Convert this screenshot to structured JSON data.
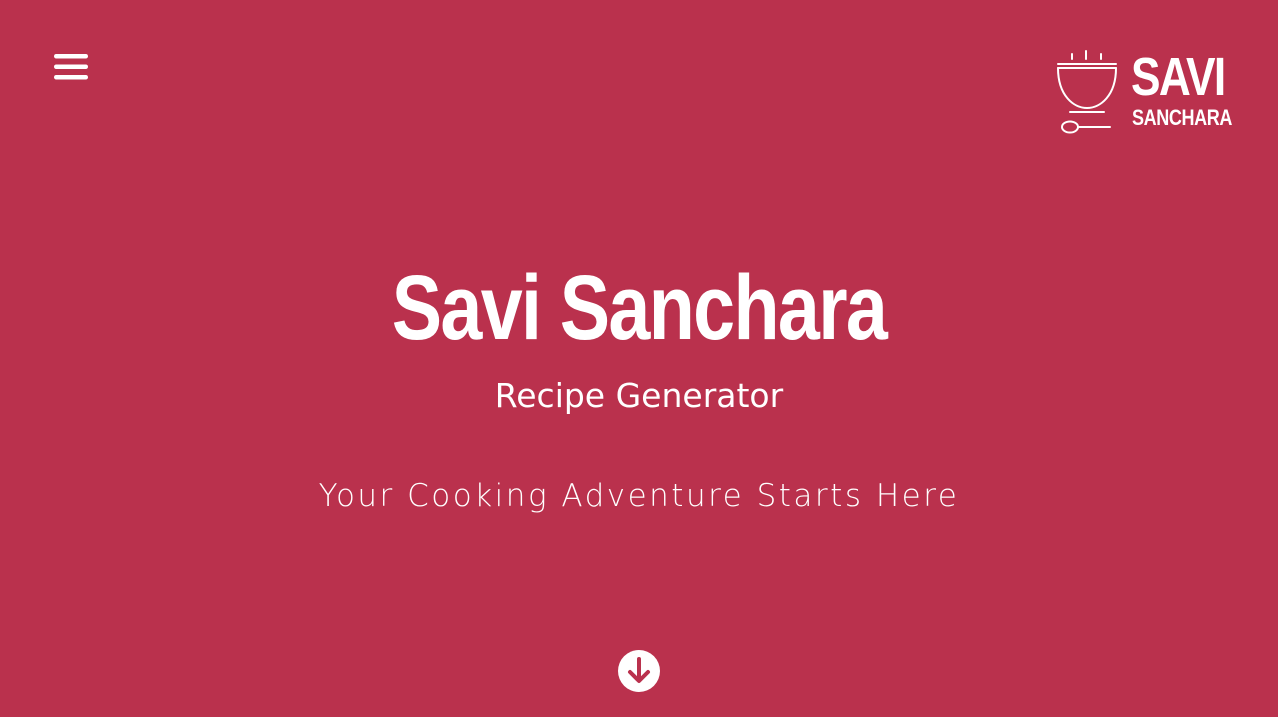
{
  "header": {
    "menu_icon": "hamburger-menu-icon",
    "logo": {
      "icon": "cooking-pot-spoon-icon",
      "line1": "SAVI",
      "line2": "SANCHARA"
    }
  },
  "hero": {
    "title": "Savi Sanchara",
    "subtitle": "Recipe Generator",
    "tagline": "Your Cooking Adventure Starts Here"
  },
  "scroll": {
    "icon": "arrow-down-circle-icon"
  },
  "colors": {
    "background": "#BA314D",
    "foreground": "#FFFFFF"
  }
}
